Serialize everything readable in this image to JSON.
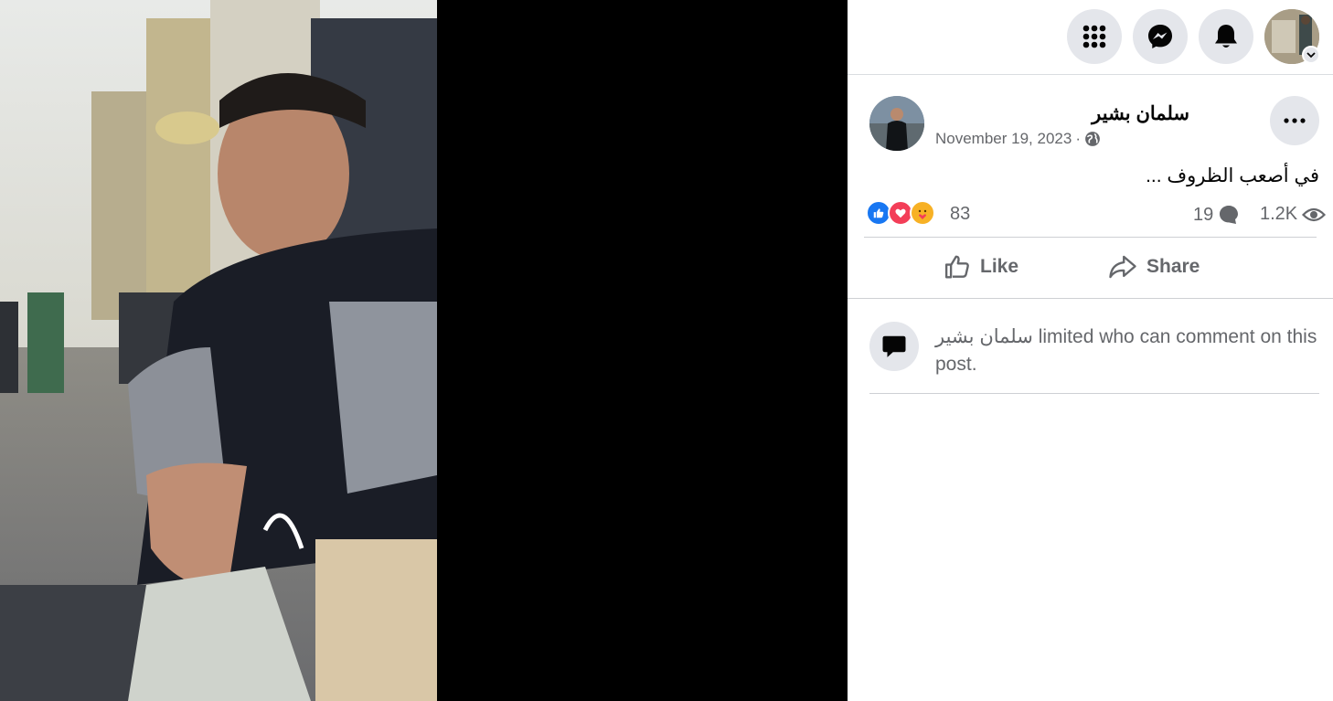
{
  "video": {
    "label": ""
  },
  "topbar": {
    "menu_icon": "grid-menu-icon",
    "messenger_icon": "messenger-icon",
    "notifications_icon": "bell-icon",
    "account_icon": "chevron-down-icon"
  },
  "post": {
    "author": "سلمان بشير",
    "date": "November 19, 2023",
    "separator": "·",
    "privacy_icon": "globe-icon",
    "text": "في أصعب الظروف ...",
    "reactions": {
      "types": [
        "like",
        "love",
        "care"
      ],
      "count": "83"
    },
    "comments_count": "19",
    "views_count": "1.2K",
    "actions": {
      "like": "Like",
      "share": "Share"
    },
    "comment_limit": {
      "author": "سلمان بشير",
      "message": " limited who can comment on this post."
    }
  },
  "colors": {
    "like_blue": "#1877f2",
    "love_red": "#f33e58",
    "care_yellow": "#f7b125",
    "text_secondary": "#65676b",
    "button_bg": "#e4e6eb"
  }
}
